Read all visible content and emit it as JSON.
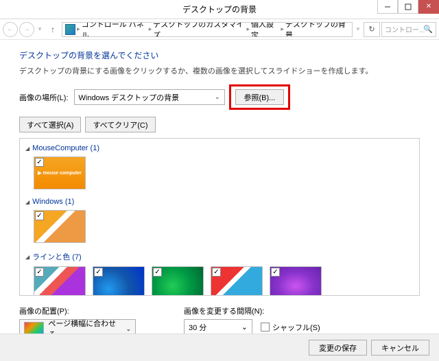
{
  "window": {
    "title": "デスクトップの背景"
  },
  "breadcrumb": {
    "items": [
      "コントロール パネル",
      "デスクトップのカスタマイズ",
      "個人設定",
      "デスクトップの背景"
    ]
  },
  "search": {
    "placeholder": "コントロー..."
  },
  "main": {
    "heading": "デスクトップの背景を選んでください",
    "subtext": "デスクトップの背景にする画像をクリックするか、複数の画像を選択してスライドショーを作成します。",
    "location_label": "画像の場所(L):",
    "location_value": "Windows デスクトップの背景",
    "browse_label": "参照(B)..."
  },
  "selection": {
    "select_all": "すべて選択(A)",
    "clear_all": "すべてクリア(C)"
  },
  "groups": [
    {
      "name": "MouseComputer",
      "count": 1
    },
    {
      "name": "Windows",
      "count": 1
    },
    {
      "name": "ラインと色",
      "count": 7
    }
  ],
  "footer": {
    "fit_label": "画像の配置(P):",
    "fit_value": "ページ横幅に合わせる",
    "interval_label": "画像を変更する間隔(N):",
    "interval_value": "30 分",
    "shuffle_label": "シャッフル(S)"
  },
  "actions": {
    "save": "変更の保存",
    "cancel": "キャンセル"
  }
}
